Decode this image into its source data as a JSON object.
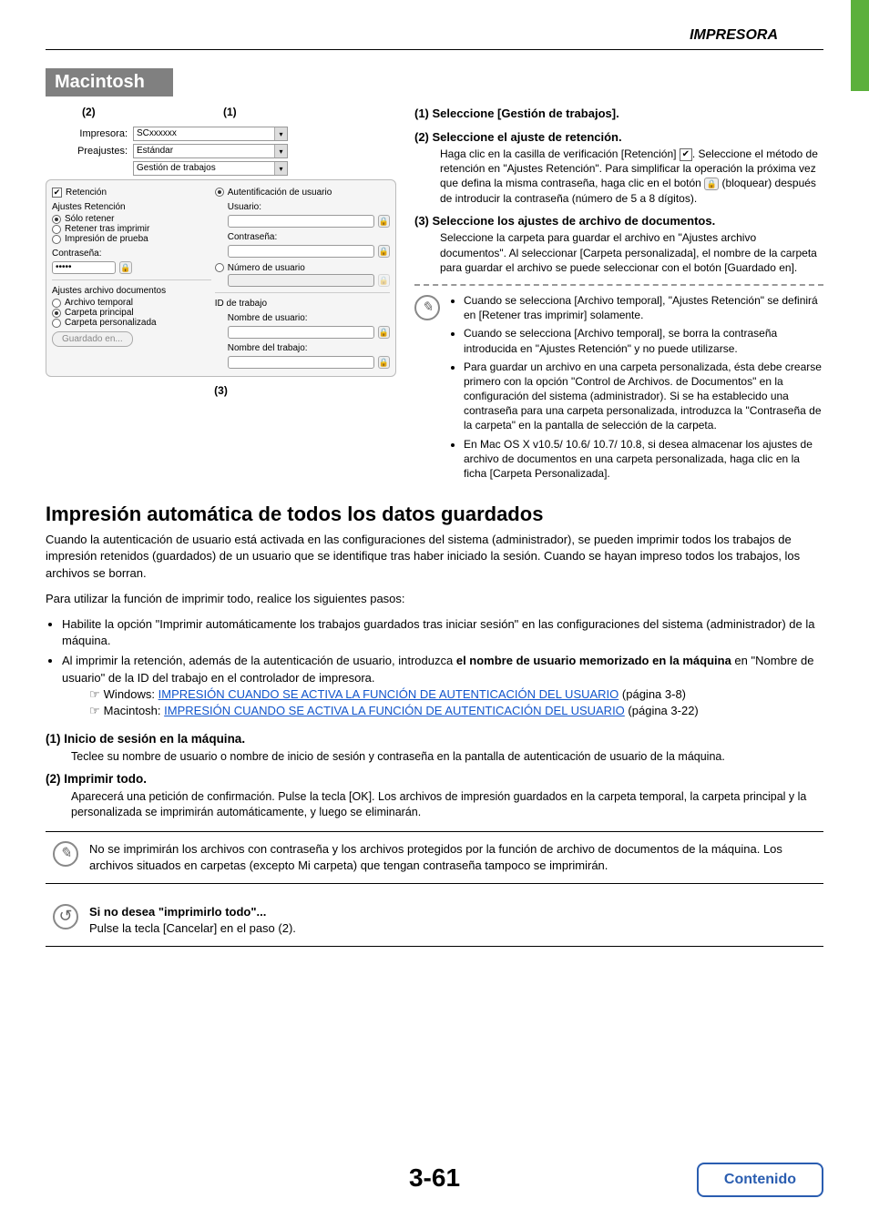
{
  "header": {
    "title": "IMPRESORA"
  },
  "banner": "Macintosh",
  "callouts": {
    "c1": "(1)",
    "c2": "(2)",
    "c3": "(3)"
  },
  "dialog": {
    "impresora_label": "Impresora:",
    "impresora_value": "SCxxxxxx",
    "preajustes_label": "Preajustes:",
    "preajustes_value": "Estándar",
    "tab_value": "Gestión de trabajos",
    "left": {
      "retencion": "Retención",
      "ajustes_ret": "Ajustes Retención",
      "solo_retener": "Sólo retener",
      "retener_tras": "Retener tras imprimir",
      "impresion_prueba": "Impresión de prueba",
      "contrasena": "Contraseña:",
      "contrasena_val": "•••••",
      "ajustes_arch": "Ajustes archivo documentos",
      "archivo_temp": "Archivo temporal",
      "carpeta_princ": "Carpeta principal",
      "carpeta_pers": "Carpeta personalizada",
      "guardado_btn": "Guardado en..."
    },
    "right": {
      "auth": "Autentificación de usuario",
      "usuario": "Usuario:",
      "contrasena": "Contraseña:",
      "num_usuario": "Número de usuario",
      "id_trabajo": "ID de trabajo",
      "nombre_usuario": "Nombre de usuario:",
      "nombre_trabajo": "Nombre del trabajo:"
    }
  },
  "steps": {
    "s1": {
      "num": "(1)",
      "title": "Seleccione [Gestión de trabajos]."
    },
    "s2": {
      "num": "(2)",
      "title": "Seleccione el ajuste de retención.",
      "body_a": "Haga clic en la casilla de verificación [Retención] ",
      "body_b": ". Seleccione el método de retención en \"Ajustes Retención\". Para simplificar la operación la próxima vez que defina la misma contraseña, haga clic en el botón ",
      "body_c": " (bloquear) después de introducir la contraseña (número de 5 a 8 dígitos)."
    },
    "s3": {
      "num": "(3)",
      "title": "Seleccione los ajustes de archivo de documentos.",
      "body": "Seleccione la carpeta para guardar el archivo en \"Ajustes archivo documentos\". Al seleccionar [Carpeta personalizada], el nombre de la carpeta para guardar el archivo se puede seleccionar con el botón [Guardado en]."
    }
  },
  "notes": {
    "n1": "Cuando se selecciona [Archivo temporal], \"Ajustes Retención\" se definirá en [Retener tras imprimir] solamente.",
    "n2": "Cuando se selecciona [Archivo temporal], se borra la contraseña introducida en \"Ajustes Retención\" y no puede utilizarse.",
    "n3": "Para guardar un archivo en una carpeta personalizada, ésta debe crearse primero con la opción \"Control de Archivos. de Documentos\" en la configuración del sistema (administrador). Si se ha establecido una contraseña para una carpeta personalizada, introduzca la \"Contraseña de la carpeta\" en la pantalla de selección de la carpeta.",
    "n4": "En Mac OS X v10.5/ 10.6/ 10.7/ 10.8, si desea almacenar los ajustes de archivo de documentos en una carpeta personalizada, haga clic en la ficha [Carpeta Personalizada]."
  },
  "h2": "Impresión automática de todos los datos guardados",
  "p1": "Cuando la autenticación de usuario está activada en las configuraciones del sistema (administrador), se pueden imprimir todos los trabajos de impresión retenidos (guardados) de un usuario que se identifique tras haber iniciado la sesión. Cuando se hayan impreso todos los trabajos, los archivos se borran.",
  "p2": "Para utilizar la función de imprimir todo, realice los siguientes pasos:",
  "b1": "Habilite la opción \"Imprimir automáticamente los trabajos guardados tras iniciar sesión\" en las configuraciones del sistema (administrador) de la máquina.",
  "b2a": "Al imprimir la retención, además de la autenticación de usuario, introduzca ",
  "b2b": "el nombre de usuario memorizado en la máquina",
  "b2c": " en \"Nombre de usuario\" de la ID del trabajo en el controlador de impresora.",
  "ref_win_label": "Windows:",
  "ref_win_link": "IMPRESIÓN CUANDO SE ACTIVA LA FUNCIÓN DE AUTENTICACIÓN DEL USUARIO",
  "ref_win_pg": " (página 3-8)",
  "ref_mac_label": "Macintosh:",
  "ref_mac_link": "IMPRESIÓN CUANDO SE ACTIVA LA FUNCIÓN DE AUTENTICACIÓN DEL USUARIO",
  "ref_mac_pg": " (página 3-22)",
  "steps2": {
    "s1": {
      "n": "(1)",
      "t": "Inicio de sesión en la máquina.",
      "d": "Teclee su nombre de usuario o nombre de inicio de sesión y contraseña en la pantalla de autenticación de usuario de la máquina."
    },
    "s2": {
      "n": "(2)",
      "t": "Imprimir todo.",
      "d": "Aparecerá una petición de confirmación. Pulse la tecla [OK]. Los archivos de impresión guardados en la carpeta temporal, la carpeta principal y la personalizada se imprimirán automáticamente, y luego se eliminarán."
    }
  },
  "info1": "No se imprimirán los archivos con contraseña y los archivos protegidos por la función de archivo de documentos de la máquina. Los archivos situados en carpetas (excepto Mi carpeta) que tengan contraseña tampoco se imprimirán.",
  "info2_title": "Si no desea \"imprimirlo todo\"...",
  "info2_body": "Pulse la tecla [Cancelar] en el paso (2).",
  "page_num": "3-61",
  "contenido": "Contenido"
}
